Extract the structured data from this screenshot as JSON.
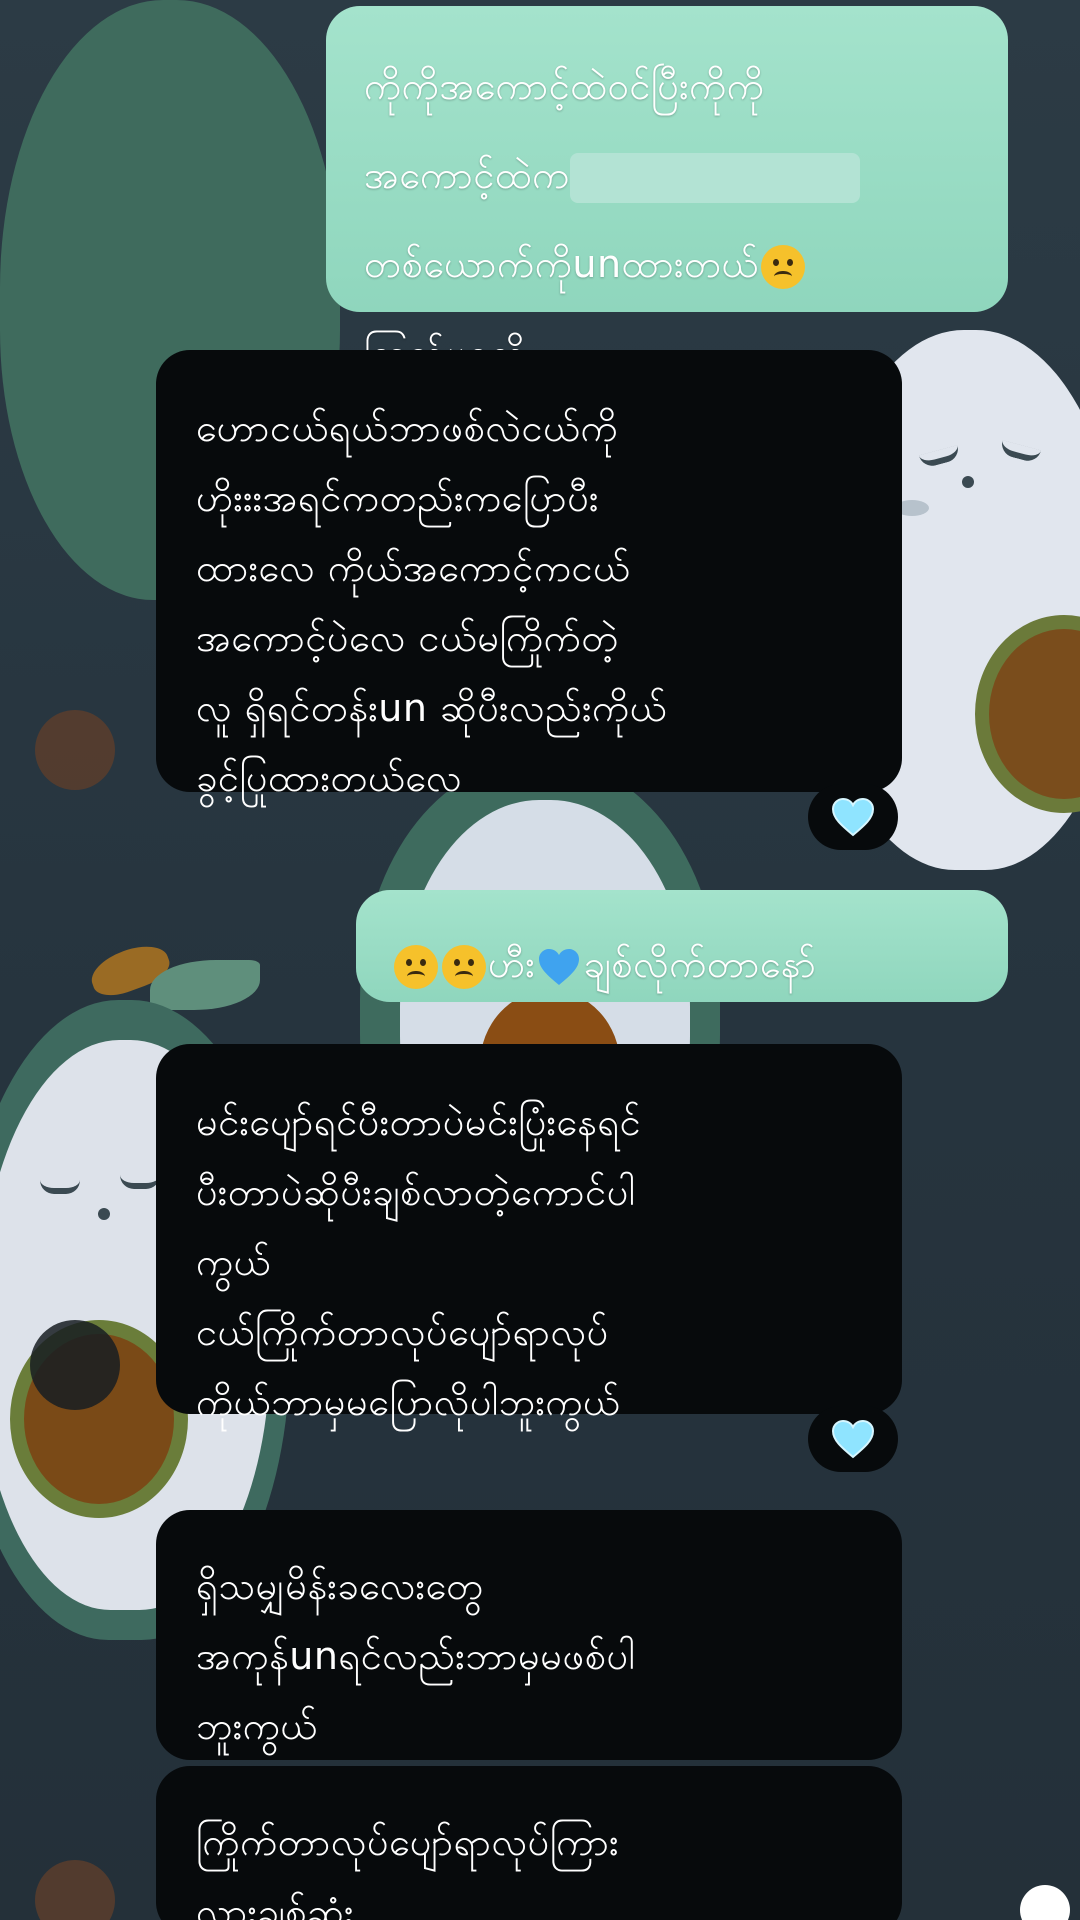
{
  "colors": {
    "sent_bubble": "#95dac2",
    "received_bubble": "#070a0c",
    "heart": "#8fe4ff",
    "emoji_face": "#f6c12b"
  },
  "messages": [
    {
      "direction": "sent",
      "lines": [
        "ကိုကိုအကောင့်ထဲဝင်ပြီးကိုကို",
        "အကောင့်ထဲက"
      ],
      "line3": "တစ်ယောက်ကိုunထားတယ်",
      "line4": "ကြည့်မရလို့",
      "emoji": "frowning-face"
    },
    {
      "direction": "received",
      "text": "ဟောငယ်ရယ်ဘာဖစ်လဲငယ်ကို\nဟိုးးးအရင်ကတည်းကပြောပီး\nထားလေ ကိုယ်အကောင့်ကငယ်\nအကောင့်ပဲလေ ငယ်မကြိုက်တဲ့\nလူ ရှိရင်တန်းun ဆိုပီးလည်းကိုယ်\nခွင့်ပြုထားတယ်လေ",
      "reaction": "light-blue-heart"
    },
    {
      "direction": "sent",
      "prefix_emojis": [
        "frowning-face",
        "frowning-face"
      ],
      "text_before_heart": "ဟီး",
      "text_after_heart": "ချစ်လိုက်တာနော်"
    },
    {
      "direction": "received",
      "text": "မင်းပျော်ရင်ပီးတာပဲမင်းပြုံးနေရင်\nပီးတာပဲဆိုပီးချစ်လာတဲ့ကောင်ပါ\nကွယ်\nငယ်ကြိုက်တာလုပ်ပျော်ရာလုပ်\nကိုယ်ဘာမှမပြောလိုပါဘူးကွယ်",
      "reaction": "light-blue-heart"
    },
    {
      "direction": "received",
      "text": "ရှိသမျှမိန်းခလေးတွေ\nအကုန်unရင်လည်းဘာမှမဖစ်ပါ\nဘူးကွယ်"
    },
    {
      "direction": "received",
      "text": "ကြိုက်တာလုပ်ပျော်ရာလုပ်ကြား\nလားချစ်ဆုံး"
    }
  ]
}
